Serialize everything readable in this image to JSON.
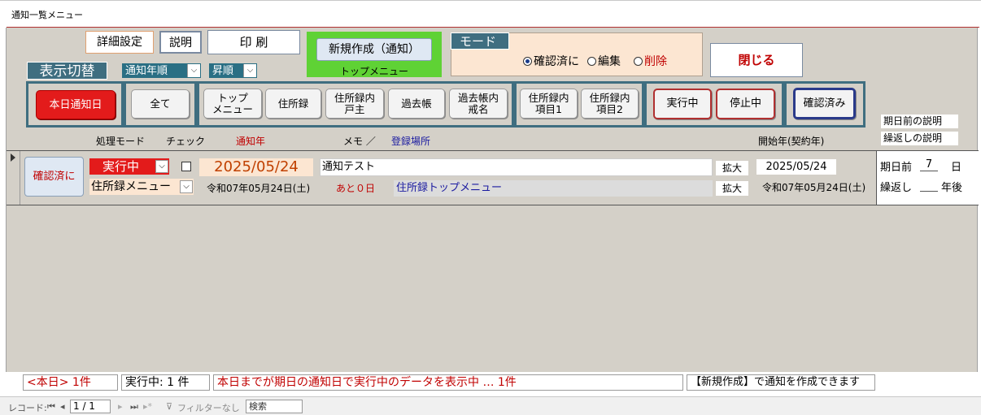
{
  "window": {
    "tab_title": "通知一覧メニュー"
  },
  "header": {
    "detail_settings": "詳細設定",
    "explain": "説明",
    "print": "印 刷",
    "new_create": "新規作成（通知）",
    "top_menu_caption": "トップメニュー",
    "mode_label": "モード",
    "display_switch": "表示切替",
    "sort_field": "通知年順",
    "sort_order": "昇順",
    "close": "閉じる",
    "mode_options": [
      {
        "label": "確認済に",
        "selected": true,
        "color": "#000000"
      },
      {
        "label": "編集",
        "selected": false,
        "color": "#000000"
      },
      {
        "label": "削除",
        "selected": false,
        "color": "#c00000"
      }
    ]
  },
  "filter_buttons": {
    "today": "本日通知日",
    "all": "全て",
    "top_menu": "トップ\nメニュー",
    "address_book": "住所録",
    "household_head": "住所録内\n戸主",
    "death_register": "過去帳",
    "death_posthumous": "過去帳内\n戒名",
    "item1": "住所録内\n項目1",
    "item2": "住所録内\n項目2",
    "running": "実行中",
    "stopped": "停止中",
    "confirmed": "確認済み"
  },
  "side_links": {
    "before_due": "期日前の説明",
    "repeat": "繰返しの説明"
  },
  "columns": {
    "mode": "処理モード",
    "check": "チェック",
    "notify_year": "通知年",
    "memo": "メモ ／",
    "location": "登録場所",
    "start_year": "開始年(契約年)"
  },
  "record": {
    "action_button": "確認済に",
    "status": "実行中",
    "category": "住所録メニュー",
    "notify_date": "2025/05/24",
    "notify_date_jp": "令和07年05月24日(土)",
    "remaining": "あと０日",
    "memo": "通知テスト",
    "expand1": "拡大",
    "location": "住所録トップメニュー",
    "expand2": "拡大",
    "start_date": "2025/05/24",
    "start_date_jp": "令和07年05月24日(土)",
    "before_due_label": "期日前",
    "before_due_value": "7",
    "before_due_unit": "日",
    "repeat_label": "繰返し",
    "repeat_value": "",
    "repeat_unit": "年後"
  },
  "status_bar": {
    "today_count": "<本日> 1件",
    "running_count": "実行中: 1 件",
    "message": "本日までが期日の通知日で実行中のデータを表示中 … 1件",
    "hint": "【新規作成】で通知を作成できます"
  },
  "nav": {
    "record_label": "レコード:",
    "position": "1 / 1",
    "filter": "フィルターなし",
    "search": "検索"
  },
  "colors": {
    "accent_teal": "#3f6e80",
    "alert_red": "#e31b1b",
    "new_green": "#5fd235"
  }
}
